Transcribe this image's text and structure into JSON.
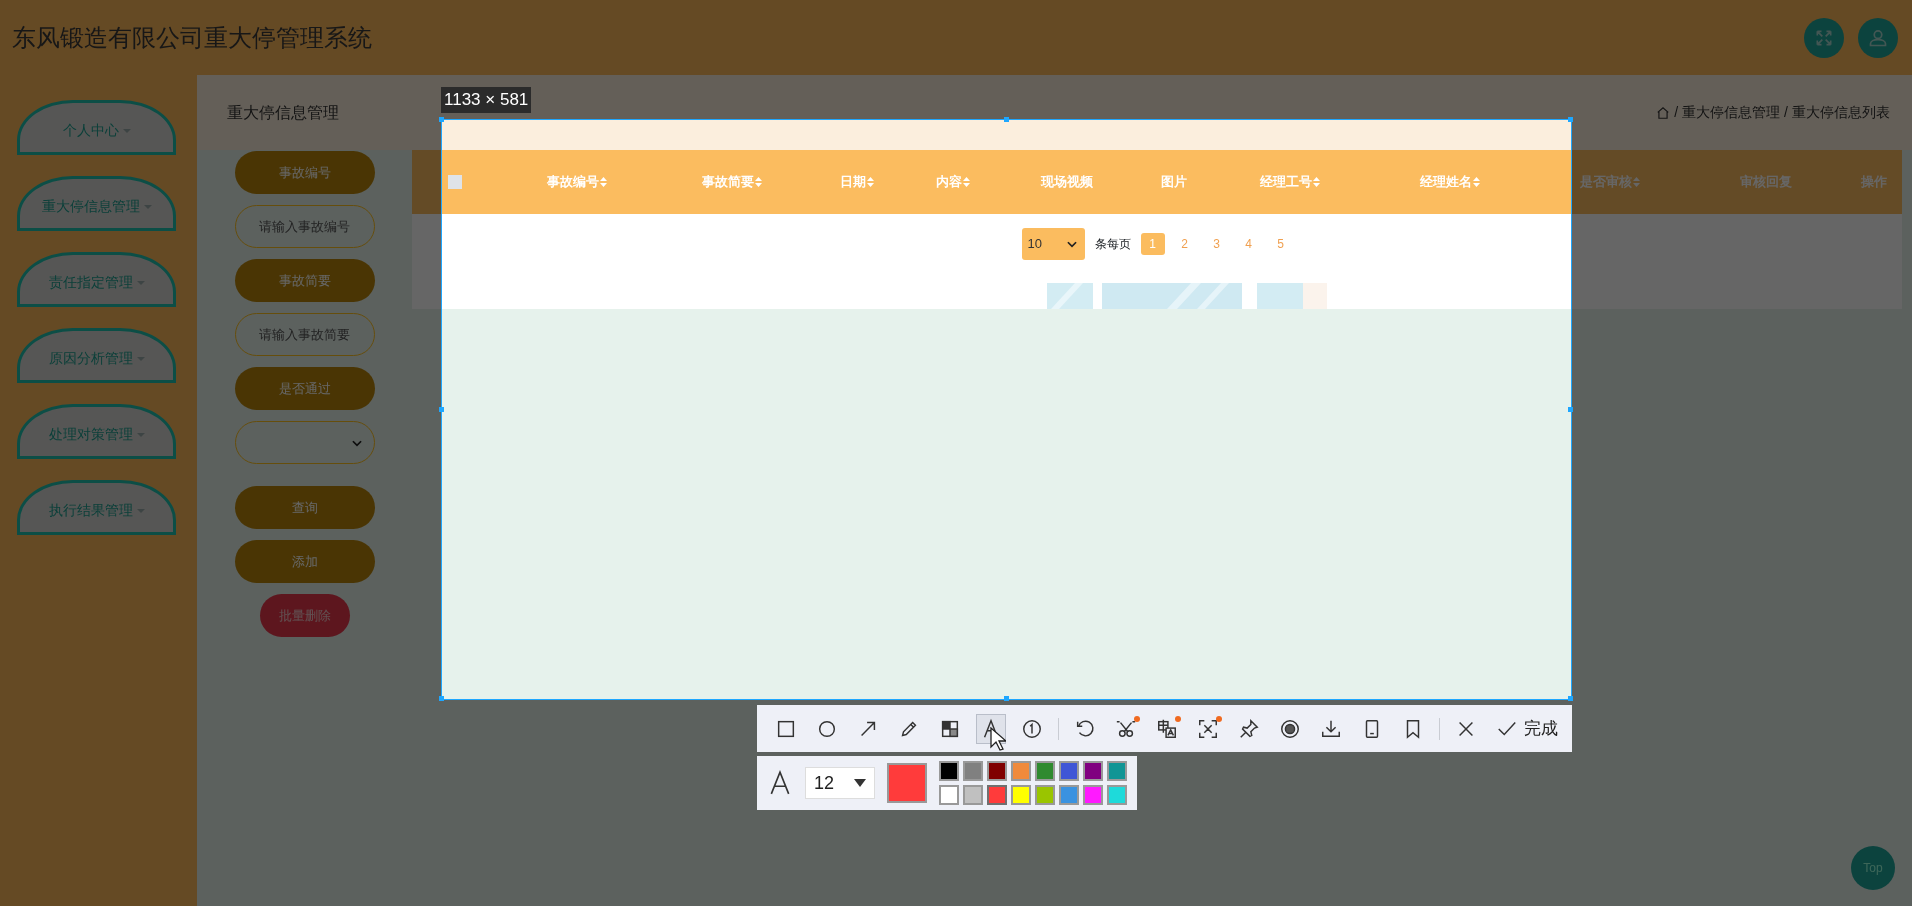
{
  "header": {
    "title": "东风锻造有限公司重大停管理系统"
  },
  "sidebar": {
    "items": [
      {
        "label": "个人中心"
      },
      {
        "label": "重大停信息管理"
      },
      {
        "label": "责任指定管理"
      },
      {
        "label": "原因分析管理"
      },
      {
        "label": "处理对策管理"
      },
      {
        "label": "执行结果管理"
      }
    ]
  },
  "page_title": "重大停信息管理",
  "breadcrumb": [
    {
      "separator": "/",
      "label": "重大停信息管理"
    },
    {
      "separator": "/",
      "label": "重大停信息列表"
    }
  ],
  "filters": [
    {
      "kind": "label",
      "text": "事故编号"
    },
    {
      "kind": "input",
      "placeholder": "请输入事故编号"
    },
    {
      "kind": "label",
      "text": "事故简要"
    },
    {
      "kind": "input",
      "placeholder": "请输入事故简要"
    },
    {
      "kind": "label",
      "text": "是否通过"
    },
    {
      "kind": "select"
    }
  ],
  "actions": [
    {
      "kind": "query",
      "label": "查询"
    },
    {
      "kind": "add",
      "label": "添加"
    },
    {
      "kind": "delete",
      "label": "批量删除"
    }
  ],
  "table": {
    "select_all": {
      "checked": false
    },
    "columns": [
      {
        "label": "事故编号",
        "sortable": true
      },
      {
        "label": "事故简要",
        "sortable": true
      },
      {
        "label": "日期",
        "sortable": true
      },
      {
        "label": "内容",
        "sortable": true
      },
      {
        "label": "现场视频",
        "sortable": false
      },
      {
        "label": "图片",
        "sortable": false
      },
      {
        "label": "经理工号",
        "sortable": true
      },
      {
        "label": "经理姓名",
        "sortable": true
      },
      {
        "label": "是否审核",
        "sortable": true
      },
      {
        "label": "审核回复",
        "sortable": false
      },
      {
        "label": "操作",
        "sortable": false
      }
    ]
  },
  "pagination": {
    "page_size": "10",
    "page_size_label": "条每页",
    "pages": [
      {
        "label": "1",
        "selected": true
      },
      {
        "label": "2",
        "selected": false
      },
      {
        "label": "3",
        "selected": false
      },
      {
        "label": "4",
        "selected": false
      },
      {
        "label": "5",
        "selected": false
      }
    ]
  },
  "capture": {
    "size_label": "1133 × 581",
    "tool_groups": [
      [
        {
          "kind": "rectangle",
          "selected": false,
          "new": false
        },
        {
          "kind": "ellipse",
          "selected": false,
          "new": false
        },
        {
          "kind": "arrow",
          "selected": false,
          "new": false
        },
        {
          "kind": "pencil",
          "selected": false,
          "new": false
        },
        {
          "kind": "mosaic",
          "selected": false,
          "new": false
        },
        {
          "kind": "text",
          "selected": true,
          "new": false
        },
        {
          "kind": "number",
          "selected": false,
          "new": false
        }
      ],
      [
        {
          "kind": "undo",
          "selected": false,
          "new": false
        },
        {
          "kind": "scissors",
          "selected": false,
          "new": true
        },
        {
          "kind": "translate",
          "selected": false,
          "new": true
        },
        {
          "kind": "scan",
          "selected": false,
          "new": true
        },
        {
          "kind": "pin",
          "selected": false,
          "new": false
        },
        {
          "kind": "record",
          "selected": false,
          "new": false
        },
        {
          "kind": "download",
          "selected": false,
          "new": false
        },
        {
          "kind": "phone",
          "selected": false,
          "new": false
        },
        {
          "kind": "bookmark",
          "selected": false,
          "new": false
        }
      ],
      [
        {
          "kind": "close",
          "selected": false,
          "new": false
        }
      ]
    ],
    "done_label": "完成",
    "text_options": {
      "font_size": "12",
      "palette": [
        {
          "color": "#000000",
          "selected": false
        },
        {
          "color": "#808080",
          "selected": false
        },
        {
          "color": "#800000",
          "selected": false
        },
        {
          "color": "#f08a3c",
          "selected": false
        },
        {
          "color": "#2f8a2f",
          "selected": false
        },
        {
          "color": "#3f55d6",
          "selected": false
        },
        {
          "color": "#800080",
          "selected": false
        },
        {
          "color": "#119595",
          "selected": false
        },
        {
          "color": "#ffffff",
          "selected": false
        },
        {
          "color": "#c0c0c0",
          "selected": false
        },
        {
          "color": "#ff3b3b",
          "selected": true
        },
        {
          "color": "#ffff00",
          "selected": false
        },
        {
          "color": "#9ac500",
          "selected": false
        },
        {
          "color": "#3a92e0",
          "selected": false
        },
        {
          "color": "#ff1aff",
          "selected": false
        },
        {
          "color": "#1edada",
          "selected": false
        }
      ]
    }
  },
  "back_to_top": {
    "label": "Top"
  }
}
